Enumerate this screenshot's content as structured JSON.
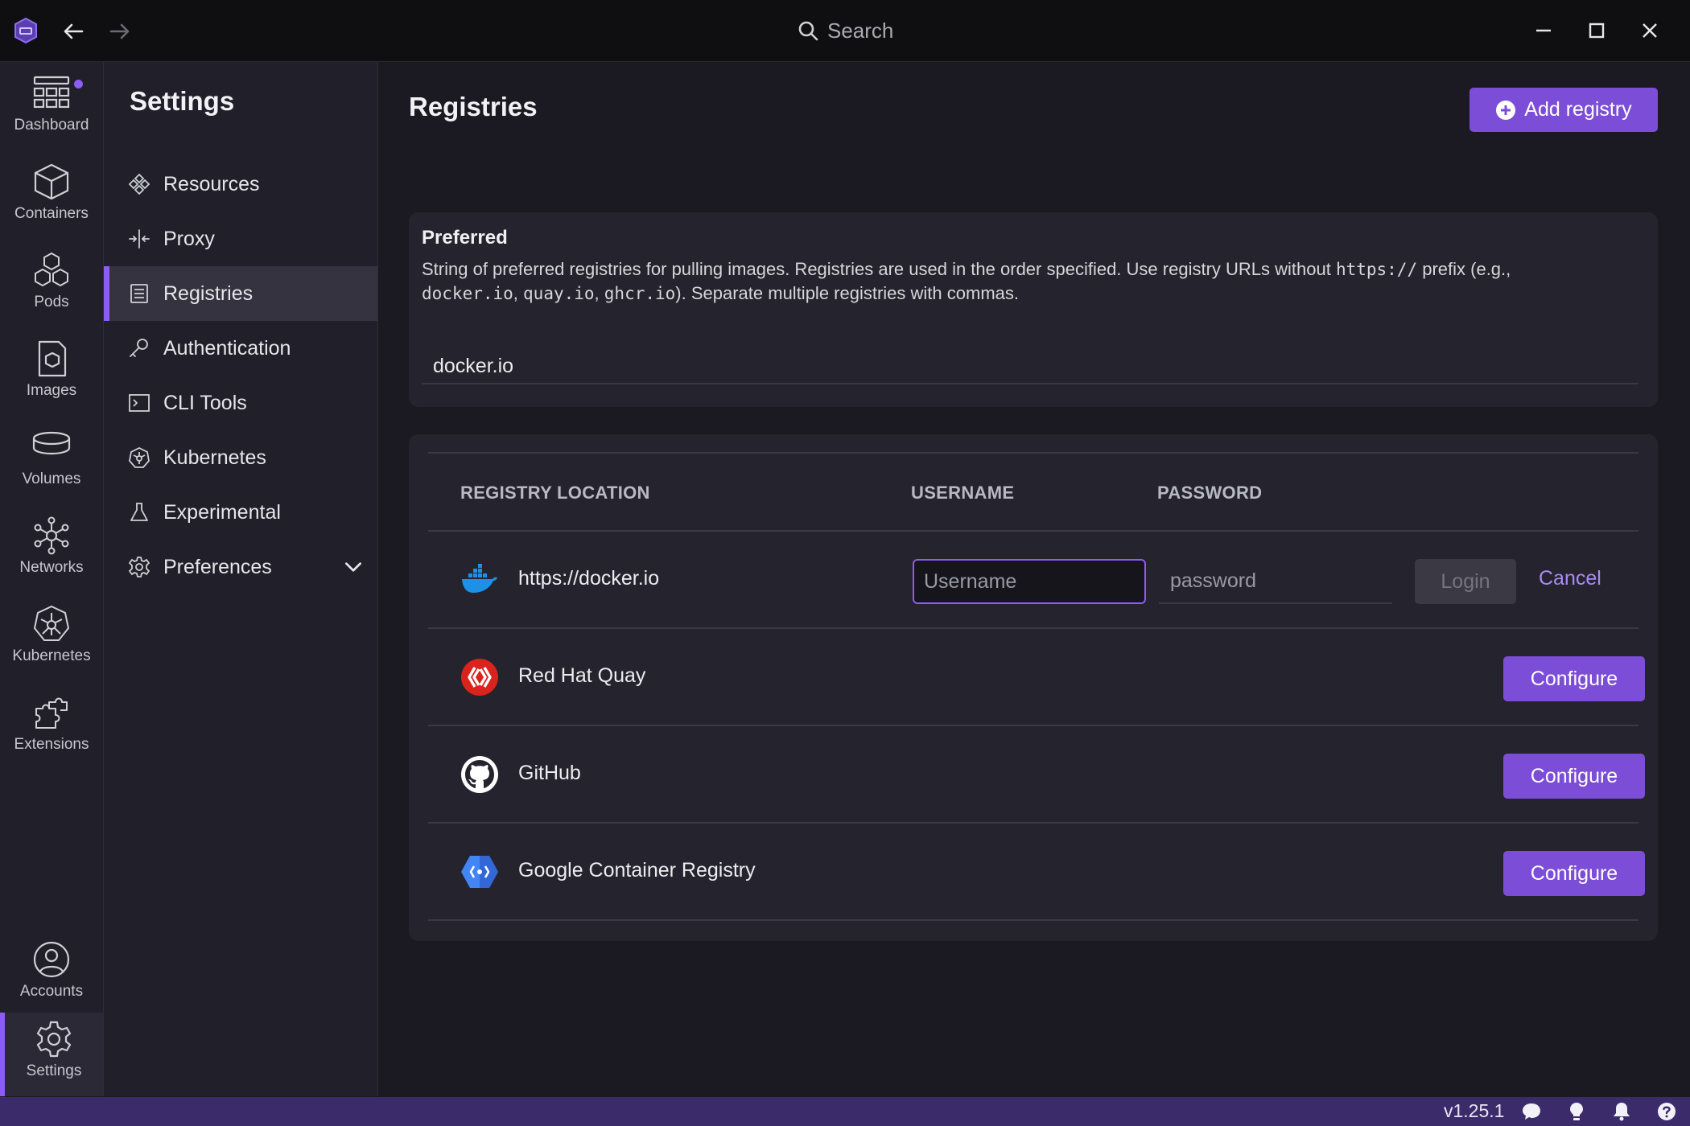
{
  "titlebar": {
    "search_label": "Search"
  },
  "rail": {
    "items": [
      {
        "label": "Dashboard"
      },
      {
        "label": "Containers"
      },
      {
        "label": "Pods"
      },
      {
        "label": "Images"
      },
      {
        "label": "Volumes"
      },
      {
        "label": "Networks"
      },
      {
        "label": "Kubernetes"
      },
      {
        "label": "Extensions"
      }
    ],
    "accounts_label": "Accounts",
    "settings_label": "Settings",
    "active": "Settings"
  },
  "sidebar": {
    "title": "Settings",
    "items": [
      {
        "label": "Resources"
      },
      {
        "label": "Proxy"
      },
      {
        "label": "Registries"
      },
      {
        "label": "Authentication"
      },
      {
        "label": "CLI Tools"
      },
      {
        "label": "Kubernetes"
      },
      {
        "label": "Experimental"
      },
      {
        "label": "Preferences"
      }
    ],
    "active": "Registries"
  },
  "main": {
    "title": "Registries",
    "add_button_label": "Add registry",
    "preferred": {
      "title": "Preferred",
      "desc_1": "String of preferred registries for pulling images. Registries are used in the order specified. Use registry URLs without ",
      "desc_code_1": "https://",
      "desc_2": " prefix (e.g.,",
      "desc_code_2": "docker.io",
      "desc_3": ", ",
      "desc_code_3": "quay.io",
      "desc_4": ", ",
      "desc_code_4": "ghcr.io",
      "desc_5": "). Separate multiple registries with commas.",
      "value": "docker.io"
    },
    "table": {
      "columns": [
        "REGISTRY LOCATION",
        "USERNAME",
        "PASSWORD"
      ],
      "rows": [
        {
          "name": "https://docker.io",
          "icon": "docker-icon",
          "username_placeholder": "Username",
          "password_placeholder": "password",
          "login_label": "Login",
          "cancel_label": "Cancel"
        },
        {
          "name": "Red Hat Quay",
          "icon": "red-hat-quay-icon",
          "action_label": "Configure"
        },
        {
          "name": "GitHub",
          "icon": "github-icon",
          "action_label": "Configure"
        },
        {
          "name": "Google Container Registry",
          "icon": "google-container-registry-icon",
          "action_label": "Configure"
        }
      ]
    }
  },
  "statusbar": {
    "version": "v1.25.1"
  },
  "colors": {
    "accent": "#7c4dd6",
    "statusbar": "#3b2b6b",
    "background": "#1b1a22"
  }
}
